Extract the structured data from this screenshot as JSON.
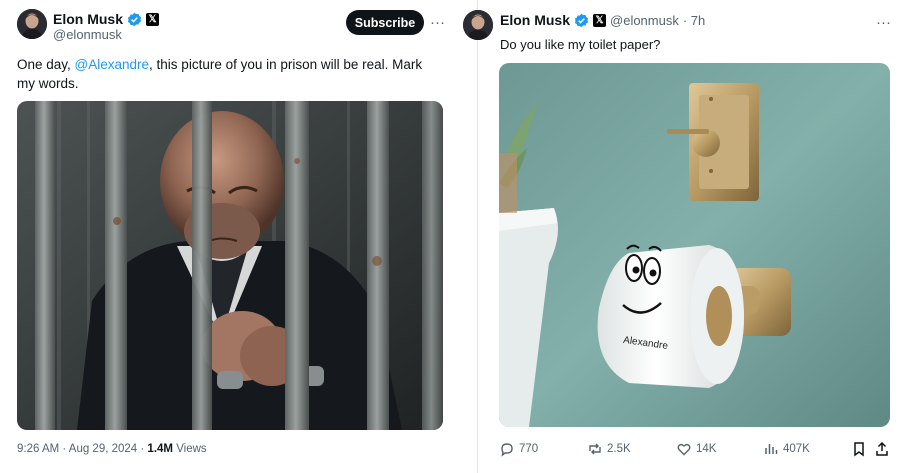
{
  "left_post": {
    "author": {
      "name": "Elon Musk",
      "handle": "@elonmusk"
    },
    "subscribe_label": "Subscribe",
    "more_label": "···",
    "text_before": "One day, ",
    "mention": "@Alexandre",
    "text_after": ", this picture of you in prison will be real. Mark my words.",
    "timestamp": "9:26 AM · Aug 29, 2024 · ",
    "views_count": "1.4M",
    "views_label": " Views"
  },
  "right_post": {
    "author": {
      "name": "Elon Musk",
      "handle": "@elonmusk",
      "time": "· 7h"
    },
    "more_label": "···",
    "text": "Do you like my toilet paper?",
    "roll_text": "Alexandre",
    "actions": {
      "replies": "770",
      "reposts": "2.5K",
      "likes": "14K",
      "views": "407K"
    }
  },
  "colors": {
    "mention_blue": "#1d9bf0",
    "verified_blue": "#1d9bf0",
    "text_dark": "#0f1419",
    "text_gray": "#536471",
    "wall_teal": "#7fa9a5"
  },
  "icons": [
    "verified-badge-icon",
    "x-logo-icon",
    "more-icon",
    "reply-icon",
    "repost-icon",
    "like-icon",
    "views-icon",
    "bookmark-icon",
    "share-icon"
  ]
}
